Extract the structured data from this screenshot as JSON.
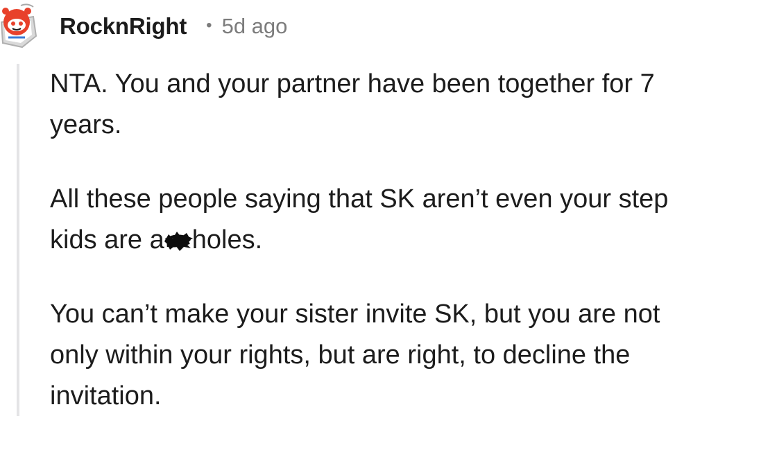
{
  "comment": {
    "author": "RocknRight",
    "separator": "•",
    "age": "5d ago",
    "paragraphs": [
      {
        "lines": [
          "NTA. You and your partner have been together for 7",
          "years."
        ]
      },
      {
        "lines": [
          "All these people saying that SK aren’t even your step"
        ],
        "line2_before": "kids are a",
        "line2_after": "holes."
      },
      {
        "lines": [
          "You can’t make your sister invite SK, but you are not",
          "only within your rights, but are right, to decline the",
          "invitation."
        ]
      }
    ]
  },
  "icons": {
    "avatar": "snoo-avatar-icon",
    "censor": "censor-scribble-icon"
  },
  "colors": {
    "text": "#1c1c1c",
    "meta": "#7c7c7c",
    "thread_line": "#e4e4e6",
    "avatar_red": "#e8412b"
  }
}
